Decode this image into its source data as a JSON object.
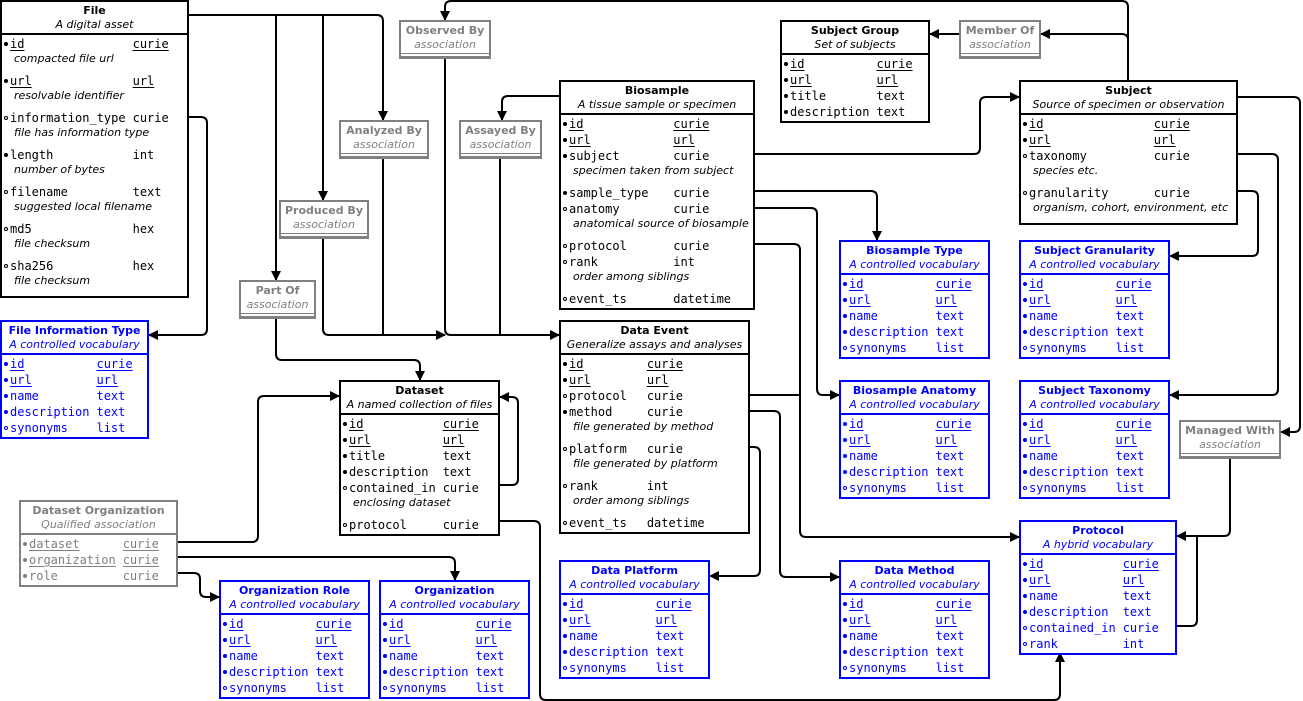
{
  "colors": {
    "entity": "#000000",
    "vocabulary": "#0000ff",
    "association": "#808080",
    "qualified": "#808080"
  },
  "tables": [
    {
      "title": "File",
      "subtitle": "A digital asset",
      "kind": "entity",
      "fields": [
        {
          "name": "id",
          "type": "curie",
          "required": true,
          "key": true,
          "desc": "compacted file url"
        },
        {
          "name": "url",
          "type": "url",
          "required": true,
          "key": true,
          "desc": "resolvable identifier"
        },
        {
          "name": "information_type",
          "type": "curie",
          "required": false,
          "desc": "file has information type"
        },
        {
          "name": "length",
          "type": "int",
          "required": true,
          "desc": "number of bytes"
        },
        {
          "name": "filename",
          "type": "text",
          "required": false,
          "desc": "suggested local filename"
        },
        {
          "name": "md5",
          "type": "hex",
          "required": false,
          "desc": "file checksum"
        },
        {
          "name": "sha256",
          "type": "hex",
          "required": false,
          "desc": "file checksum"
        }
      ]
    },
    {
      "title": "Observed By",
      "subtitle": "association",
      "kind": "association",
      "fields": []
    },
    {
      "title": "Analyzed By",
      "subtitle": "association",
      "kind": "association",
      "fields": []
    },
    {
      "title": "Assayed By",
      "subtitle": "association",
      "kind": "association",
      "fields": []
    },
    {
      "title": "Produced By",
      "subtitle": "association",
      "kind": "association",
      "fields": []
    },
    {
      "title": "Part Of",
      "subtitle": "association",
      "kind": "association",
      "fields": []
    },
    {
      "title": "File Information Type",
      "subtitle": "A controlled vocabulary",
      "kind": "vocabulary",
      "fields": [
        {
          "name": "id",
          "type": "curie",
          "required": true,
          "key": true
        },
        {
          "name": "url",
          "type": "url",
          "required": true,
          "key": true
        },
        {
          "name": "name",
          "type": "text",
          "required": true
        },
        {
          "name": "description",
          "type": "text",
          "required": true
        },
        {
          "name": "synonyms",
          "type": "list",
          "required": false
        }
      ]
    },
    {
      "title": "Biosample",
      "subtitle": "A tissue sample or specimen",
      "kind": "entity",
      "fields": [
        {
          "name": "id",
          "type": "curie",
          "required": true,
          "key": true
        },
        {
          "name": "url",
          "type": "url",
          "required": true,
          "key": true
        },
        {
          "name": "subject",
          "type": "curie",
          "required": true,
          "desc": "specimen taken from subject"
        },
        {
          "name": "sample_type",
          "type": "curie",
          "required": true
        },
        {
          "name": "anatomy",
          "type": "curie",
          "required": false,
          "desc": "anatomical source of biosample"
        },
        {
          "name": "protocol",
          "type": "curie",
          "required": false
        },
        {
          "name": "rank",
          "type": "int",
          "required": false,
          "desc": "order among siblings"
        },
        {
          "name": "event_ts",
          "type": "datetime",
          "required": false
        }
      ]
    },
    {
      "title": "Subject Group",
      "subtitle": "Set of subjects",
      "kind": "entity",
      "fields": [
        {
          "name": "id",
          "type": "curie",
          "required": true,
          "key": true
        },
        {
          "name": "url",
          "type": "url",
          "required": true,
          "key": true
        },
        {
          "name": "title",
          "type": "text",
          "required": true
        },
        {
          "name": "description",
          "type": "text",
          "required": true
        }
      ]
    },
    {
      "title": "Member Of",
      "subtitle": "association",
      "kind": "association",
      "fields": []
    },
    {
      "title": "Subject",
      "subtitle": "Source of specimen or observation",
      "kind": "entity",
      "fields": [
        {
          "name": "id",
          "type": "curie",
          "required": true,
          "key": true
        },
        {
          "name": "url",
          "type": "url",
          "required": true,
          "key": true
        },
        {
          "name": "taxonomy",
          "type": "curie",
          "required": false,
          "desc": "species etc."
        },
        {
          "name": "granularity",
          "type": "curie",
          "required": false,
          "desc": "organism, cohort, environment, etc"
        }
      ]
    },
    {
      "title": "Biosample Type",
      "subtitle": "A controlled vocabulary",
      "kind": "vocabulary",
      "fields": [
        {
          "name": "id",
          "type": "curie",
          "required": true,
          "key": true
        },
        {
          "name": "url",
          "type": "url",
          "required": true,
          "key": true
        },
        {
          "name": "name",
          "type": "text",
          "required": true
        },
        {
          "name": "description",
          "type": "text",
          "required": true
        },
        {
          "name": "synonyms",
          "type": "list",
          "required": false
        }
      ]
    },
    {
      "title": "Subject Granularity",
      "subtitle": "A controlled vocabulary",
      "kind": "vocabulary",
      "fields": [
        {
          "name": "id",
          "type": "curie",
          "required": true,
          "key": true
        },
        {
          "name": "url",
          "type": "url",
          "required": true,
          "key": true
        },
        {
          "name": "name",
          "type": "text",
          "required": true
        },
        {
          "name": "description",
          "type": "text",
          "required": true
        },
        {
          "name": "synonyms",
          "type": "list",
          "required": false
        }
      ]
    },
    {
      "title": "Data Event",
      "subtitle": "Generalize assays and analyses",
      "kind": "entity",
      "fields": [
        {
          "name": "id",
          "type": "curie",
          "required": true,
          "key": true
        },
        {
          "name": "url",
          "type": "url",
          "required": true,
          "key": true
        },
        {
          "name": "protocol",
          "type": "curie",
          "required": false
        },
        {
          "name": "method",
          "type": "curie",
          "required": true,
          "desc": "file generated by method"
        },
        {
          "name": "platform",
          "type": "curie",
          "required": false,
          "desc": "file generated by platform"
        },
        {
          "name": "rank",
          "type": "int",
          "required": false,
          "desc": "order among siblings"
        },
        {
          "name": "event_ts",
          "type": "datetime",
          "required": false
        }
      ]
    },
    {
      "title": "Dataset",
      "subtitle": "A named collection of files",
      "kind": "entity",
      "fields": [
        {
          "name": "id",
          "type": "curie",
          "required": true,
          "key": true
        },
        {
          "name": "url",
          "type": "url",
          "required": true,
          "key": true
        },
        {
          "name": "title",
          "type": "text",
          "required": true
        },
        {
          "name": "description",
          "type": "text",
          "required": true
        },
        {
          "name": "contained_in",
          "type": "curie",
          "required": false,
          "desc": "enclosing dataset"
        },
        {
          "name": "protocol",
          "type": "curie",
          "required": false
        }
      ]
    },
    {
      "title": "Biosample Anatomy",
      "subtitle": "A controlled vocabulary",
      "kind": "vocabulary",
      "fields": [
        {
          "name": "id",
          "type": "curie",
          "required": true,
          "key": true
        },
        {
          "name": "url",
          "type": "url",
          "required": true,
          "key": true
        },
        {
          "name": "name",
          "type": "text",
          "required": true
        },
        {
          "name": "description",
          "type": "text",
          "required": true
        },
        {
          "name": "synonyms",
          "type": "list",
          "required": false
        }
      ]
    },
    {
      "title": "Subject Taxonomy",
      "subtitle": "A controlled vocabulary",
      "kind": "vocabulary",
      "fields": [
        {
          "name": "id",
          "type": "curie",
          "required": true,
          "key": true
        },
        {
          "name": "url",
          "type": "url",
          "required": true,
          "key": true
        },
        {
          "name": "name",
          "type": "text",
          "required": true
        },
        {
          "name": "description",
          "type": "text",
          "required": true
        },
        {
          "name": "synonyms",
          "type": "list",
          "required": false
        }
      ]
    },
    {
      "title": "Managed With",
      "subtitle": "association",
      "kind": "association",
      "fields": []
    },
    {
      "title": "Dataset Organization",
      "subtitle": "Qualified association",
      "kind": "qualified",
      "fields": [
        {
          "name": "dataset",
          "type": "curie",
          "required": true,
          "key": true
        },
        {
          "name": "organization",
          "type": "curie",
          "required": true,
          "key": true
        },
        {
          "name": "role",
          "type": "curie",
          "required": true
        }
      ]
    },
    {
      "title": "Protocol",
      "subtitle": "A hybrid vocabulary",
      "kind": "vocabulary",
      "fields": [
        {
          "name": "id",
          "type": "curie",
          "required": true,
          "key": true
        },
        {
          "name": "url",
          "type": "url",
          "required": true,
          "key": true
        },
        {
          "name": "name",
          "type": "text",
          "required": true
        },
        {
          "name": "description",
          "type": "text",
          "required": true
        },
        {
          "name": "contained_in",
          "type": "curie",
          "required": false
        },
        {
          "name": "rank",
          "type": "int",
          "required": false
        }
      ]
    },
    {
      "title": "Organization Role",
      "subtitle": "A controlled vocabulary",
      "kind": "vocabulary",
      "fields": [
        {
          "name": "id",
          "type": "curie",
          "required": true,
          "key": true
        },
        {
          "name": "url",
          "type": "url",
          "required": true,
          "key": true
        },
        {
          "name": "name",
          "type": "text",
          "required": true
        },
        {
          "name": "description",
          "type": "text",
          "required": true
        },
        {
          "name": "synonyms",
          "type": "list",
          "required": false
        }
      ]
    },
    {
      "title": "Organization",
      "subtitle": "A controlled vocabulary",
      "kind": "vocabulary",
      "fields": [
        {
          "name": "id",
          "type": "curie",
          "required": true,
          "key": true
        },
        {
          "name": "url",
          "type": "url",
          "required": true,
          "key": true
        },
        {
          "name": "name",
          "type": "text",
          "required": true
        },
        {
          "name": "description",
          "type": "text",
          "required": true
        },
        {
          "name": "synonyms",
          "type": "list",
          "required": false
        }
      ]
    },
    {
      "title": "Data Platform",
      "subtitle": "A controlled vocabulary",
      "kind": "vocabulary",
      "fields": [
        {
          "name": "id",
          "type": "curie",
          "required": true,
          "key": true
        },
        {
          "name": "url",
          "type": "url",
          "required": true,
          "key": true
        },
        {
          "name": "name",
          "type": "text",
          "required": true
        },
        {
          "name": "description",
          "type": "text",
          "required": true
        },
        {
          "name": "synonyms",
          "type": "list",
          "required": false
        }
      ]
    },
    {
      "title": "Data Method",
      "subtitle": "A controlled vocabulary",
      "kind": "vocabulary",
      "fields": [
        {
          "name": "id",
          "type": "curie",
          "required": true,
          "key": true
        },
        {
          "name": "url",
          "type": "url",
          "required": true,
          "key": true
        },
        {
          "name": "name",
          "type": "text",
          "required": true
        },
        {
          "name": "description",
          "type": "text",
          "required": true
        },
        {
          "name": "synonyms",
          "type": "list",
          "required": false
        }
      ]
    }
  ]
}
